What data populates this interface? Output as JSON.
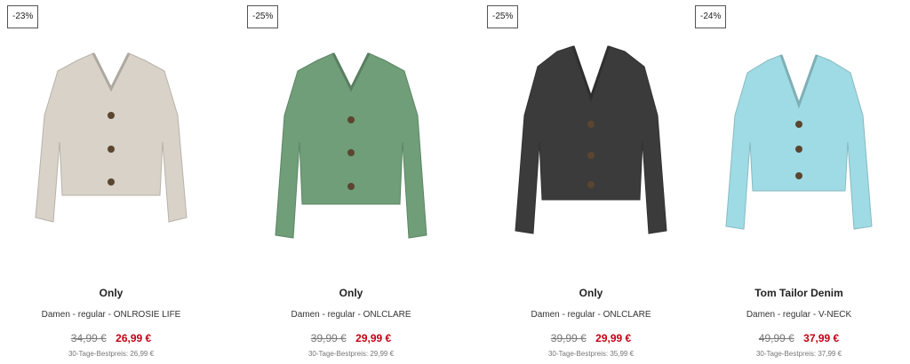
{
  "products": [
    {
      "discount": "-23%",
      "brand": "Only",
      "description": "Damen - regular - ONLROSIE LIFE",
      "old_price": "34,99 €",
      "new_price": "26,99 €",
      "best_price": "30-Tage-Bestpreis: 26,99 €",
      "color": "#d8d2c8"
    },
    {
      "discount": "-25%",
      "brand": "Only",
      "description": "Damen - regular - ONLCLARE",
      "old_price": "39,99 €",
      "new_price": "29,99 €",
      "best_price": "30-Tage-Bestpreis: 29,99 €",
      "color": "#6f9e78"
    },
    {
      "discount": "-25%",
      "brand": "Only",
      "description": "Damen - regular - ONLCLARE",
      "old_price": "39,99 €",
      "new_price": "29,99 €",
      "best_price": "30-Tage-Bestpreis: 35,99 €",
      "color": "#3b3b3b"
    },
    {
      "discount": "-24%",
      "brand": "Tom Tailor Denim",
      "description": "Damen - regular - V-NECK",
      "old_price": "49,99 €",
      "new_price": "37,99 €",
      "best_price": "30-Tage-Bestpreis: 37,99 €",
      "color": "#9fdbe4"
    }
  ]
}
